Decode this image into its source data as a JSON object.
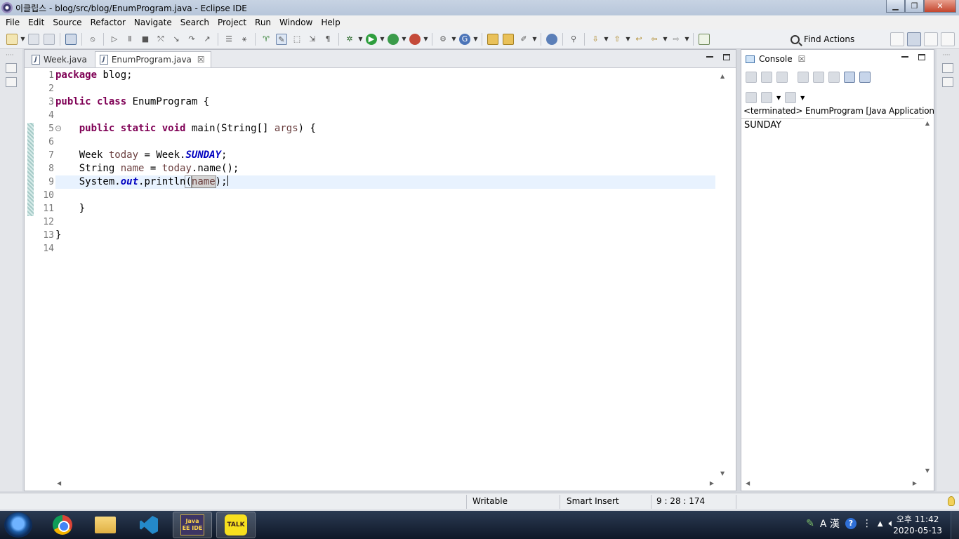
{
  "window": {
    "title": "이클립스 - blog/src/blog/EnumProgram.java - Eclipse IDE"
  },
  "menu": [
    "File",
    "Edit",
    "Source",
    "Refactor",
    "Navigate",
    "Search",
    "Project",
    "Run",
    "Window",
    "Help"
  ],
  "toolbar": {
    "find_actions": "Find Actions"
  },
  "editor": {
    "tabs": [
      {
        "label": "Week.java",
        "active": false
      },
      {
        "label": "EnumProgram.java",
        "active": true,
        "close": "☒"
      }
    ],
    "line_numbers": [
      "1",
      "2",
      "3",
      "4",
      "5",
      "6",
      "7",
      "8",
      "9",
      "10",
      "11",
      "12",
      "13",
      "14"
    ],
    "code": {
      "l1_kw": "package",
      "l1_rest": " blog;",
      "l3_kw1": "public",
      "l3_kw2": "class",
      "l3_rest": " EnumProgram {",
      "l5_kw1": "public",
      "l5_kw2": "static",
      "l5_kw3": "void",
      "l5_a": " main(String[] ",
      "l5_var": "args",
      "l5_b": ") {",
      "l7_a": "Week ",
      "l7_var": "today",
      "l7_b": " = Week.",
      "l7_fld": "SUNDAY",
      "l7_c": ";",
      "l8_a": "String ",
      "l8_var1": "name",
      "l8_b": " = ",
      "l8_var2": "today",
      "l8_c": ".name();",
      "l9_a": "System.",
      "l9_fld": "out",
      "l9_b": ".println",
      "l9_p1": "(",
      "l9_var": "name",
      "l9_p2": ")",
      "l9_c": ";",
      "l11": "}",
      "l13": "}"
    }
  },
  "console": {
    "tab_label": "Console",
    "terminated": "<terminated> EnumProgram [Java Application] C:\\",
    "output": "SUNDAY"
  },
  "status": {
    "writable": "Writable",
    "insert_mode": "Smart Insert",
    "position": "9 : 28 : 174"
  },
  "taskbar": {
    "eclipse_label": "Java EE IDE",
    "talk_label": "TALK",
    "tray_ime": "A 漢",
    "tray_help": "?",
    "clock_time": "오후 11:42",
    "clock_date": "2020-05-13"
  },
  "colors": {
    "keyword": "#7f0055",
    "field": "#0000c0",
    "local_var": "#6a3e3e",
    "current_line": "#e8f2fe"
  }
}
